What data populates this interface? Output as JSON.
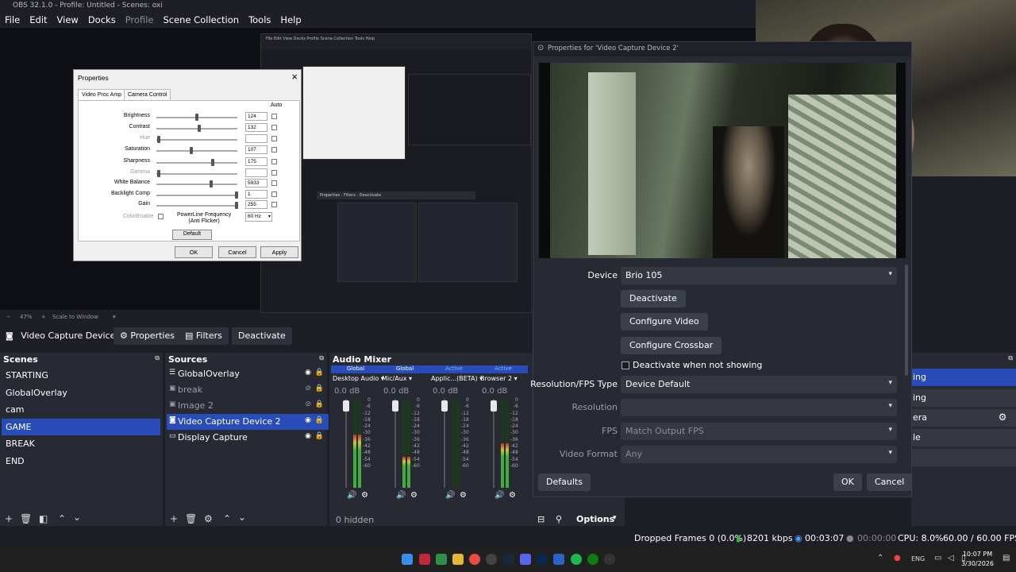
{
  "window": {
    "title": "OBS 32.1.0 - Profile: Untitled - Scenes: oxi"
  },
  "menu": [
    "File",
    "Edit",
    "View",
    "Docks",
    "Profile",
    "Scene Collection",
    "Tools",
    "Help"
  ],
  "zoom": {
    "percent": "47%",
    "plus": "+",
    "mode": "Scale to Window"
  },
  "context_bar": {
    "source_name": "Video Capture Device 2",
    "properties": "Properties",
    "filters": "Filters",
    "deactivate": "Deactivate"
  },
  "properties_dialog": {
    "title": "Properties",
    "tabs": [
      "Video Proc Amp",
      "Camera Control"
    ],
    "auto_header": "Auto",
    "rows": [
      {
        "label": "Brightness",
        "value": "124",
        "level": 0.49,
        "disabled": false
      },
      {
        "label": "Contrast",
        "value": "132",
        "level": 0.52,
        "disabled": false
      },
      {
        "label": "Hue",
        "value": "",
        "level": 0.0,
        "disabled": true
      },
      {
        "label": "Saturation",
        "value": "107",
        "level": 0.42,
        "disabled": false
      },
      {
        "label": "Sharpness",
        "value": "175",
        "level": 0.69,
        "disabled": false
      },
      {
        "label": "Gamma",
        "value": "",
        "level": 0.0,
        "disabled": true
      },
      {
        "label": "White Balance",
        "value": "5933",
        "level": 0.67,
        "disabled": false
      },
      {
        "label": "Backlight Comp",
        "value": "1",
        "level": 1.0,
        "disabled": false
      },
      {
        "label": "Gain",
        "value": "255",
        "level": 1.0,
        "disabled": false
      }
    ],
    "color_enable": "ColorEnable",
    "powerline_label": "PowerLine Frequency\n(Anti Flicker)",
    "powerline_value": "60 Hz",
    "default_btn": "Default",
    "ok": "OK",
    "cancel": "Cancel",
    "apply": "Apply"
  },
  "video_dialog": {
    "title": "Properties for 'Video Capture Device 2'",
    "device_label": "Device",
    "device_value": "Brio 105",
    "deactivate": "Deactivate",
    "configure_video": "Configure Video",
    "configure_crossbar": "Configure Crossbar",
    "deactivate_when_not_showing": "Deactivate when not showing",
    "res_fps_label": "Resolution/FPS Type",
    "res_fps_value": "Device Default",
    "resolution_label": "Resolution",
    "resolution_value": "",
    "fps_label": "FPS",
    "fps_value": "Match Output FPS",
    "video_format_label": "Video Format",
    "video_format_value": "Any",
    "defaults": "Defaults",
    "ok": "OK",
    "cancel": "Cancel"
  },
  "scenes": {
    "title": "Scenes",
    "items": [
      "STARTING",
      "GlobalOverlay",
      "cam",
      "GAME",
      "BREAK",
      "END"
    ],
    "selected": "GAME"
  },
  "sources": {
    "title": "Sources",
    "items": [
      {
        "name": "GlobalOverlay",
        "icon": "list-icon",
        "visible": true
      },
      {
        "name": "break",
        "icon": "image-icon",
        "visible": false
      },
      {
        "name": "Image 2",
        "icon": "image-icon",
        "visible": false
      },
      {
        "name": "Video Capture Device 2",
        "icon": "camera-icon",
        "visible": true
      },
      {
        "name": "Display Capture",
        "icon": "monitor-icon",
        "visible": true
      }
    ],
    "selected": "Video Capture Device 2"
  },
  "mixer": {
    "title": "Audio Mixer",
    "channels": [
      {
        "badge": "Global",
        "name": "Desktop Audio",
        "db": "0.0 dB",
        "level": 0.6
      },
      {
        "badge": "Global",
        "name": "Mic/Aux",
        "db": "0.0 dB",
        "level": 0.35
      },
      {
        "badge": "Active",
        "name": "Applic...(BETA)",
        "db": "0.0 dB",
        "level": 0.0
      },
      {
        "badge": "Active",
        "name": "Browser 2",
        "db": "0.0 dB",
        "level": 0.5
      }
    ],
    "scale": [
      "0",
      "-6",
      "-12",
      "-18",
      "-24",
      "-30",
      "-36",
      "-42",
      "-48",
      "-54",
      "-60"
    ],
    "hidden": "0 hidden",
    "options": "Options"
  },
  "right_dock": {
    "items": [
      "ing",
      "ing",
      "era",
      "le"
    ]
  },
  "status": {
    "dropped": "Dropped Frames 0 (0.0%)",
    "kbps": "8201 kbps",
    "rec_time": "00:03:07",
    "stream_time": "00:00:00",
    "cpu": "CPU: 8.0%",
    "fps": "60.00 / 60.00 FPS"
  },
  "taskbar": {
    "lang": "ENG",
    "time": "10:07 PM",
    "date": "3/30/2026"
  },
  "colors": {
    "accent": "#284cb8",
    "background": "#1e1f26",
    "panel": "#272a33"
  }
}
